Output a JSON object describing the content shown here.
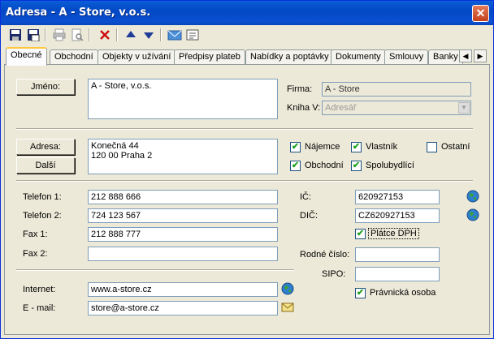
{
  "window": {
    "title": "Adresa - A - Store, v.o.s.",
    "close": "✕"
  },
  "tabs": [
    {
      "label": "Obecné"
    },
    {
      "label": "Obchodní"
    },
    {
      "label": "Objekty v užívání"
    },
    {
      "label": "Předpisy plateb"
    },
    {
      "label": "Nabídky a poptávky"
    },
    {
      "label": "Dokumenty"
    },
    {
      "label": "Smlouvy"
    },
    {
      "label": "Banky"
    }
  ],
  "tab_scroll": {
    "left": "◀",
    "right": "▶"
  },
  "form": {
    "jmeno_button": "Jméno:",
    "jmeno_value": "A - Store, v.o.s.",
    "firma_label": "Firma:",
    "firma_value": "A - Store",
    "kniha_label": "Kniha V:",
    "kniha_value": "Adresář",
    "adresa_button": "Adresa:",
    "dalsi_button": "Další",
    "adresa_value": "Konečná 44\n120 00 Praha 2",
    "checkboxes": {
      "najemce": {
        "label": "Nájemce",
        "checked": "✔"
      },
      "vlastnik": {
        "label": "Vlastník",
        "checked": "✔"
      },
      "ostatni": {
        "label": "Ostatní",
        "checked": ""
      },
      "obchodni": {
        "label": "Obchodní",
        "checked": "✔"
      },
      "spolubydlici": {
        "label": "Spolubydlící",
        "checked": "✔"
      },
      "platce_dph": {
        "label": "Plátce DPH",
        "checked": "✔"
      },
      "pravnicka": {
        "label": "Právnická osoba",
        "checked": "✔"
      }
    },
    "telefon1_label": "Telefon 1:",
    "telefon1_value": "212 888 666",
    "telefon2_label": "Telefon 2:",
    "telefon2_value": "724 123 567",
    "fax1_label": "Fax 1:",
    "fax1_value": "212 888 777",
    "fax2_label": "Fax 2:",
    "fax2_value": "",
    "ic_label": "IČ:",
    "ic_value": "620927153",
    "dic_label": "DIČ:",
    "dic_value": "CZ620927153",
    "rodne_label": "Rodné číslo:",
    "rodne_value": "",
    "sipo_label": "SIPO:",
    "sipo_value": "",
    "internet_label": "Internet:",
    "internet_value": "www.a-store.cz",
    "email_label": "E - mail:",
    "email_value": "store@a-store.cz"
  },
  "colors": {
    "titlebar": "#0a4fd0",
    "check": "#21a121",
    "tab_highlight": "#ffc83c"
  },
  "icons": [
    "save-icon",
    "save-as-icon",
    "print-icon",
    "print-preview-icon",
    "delete-icon",
    "arrow-up-icon",
    "arrow-down-icon",
    "envelope-icon",
    "address-card-icon",
    "globe-icon"
  ]
}
